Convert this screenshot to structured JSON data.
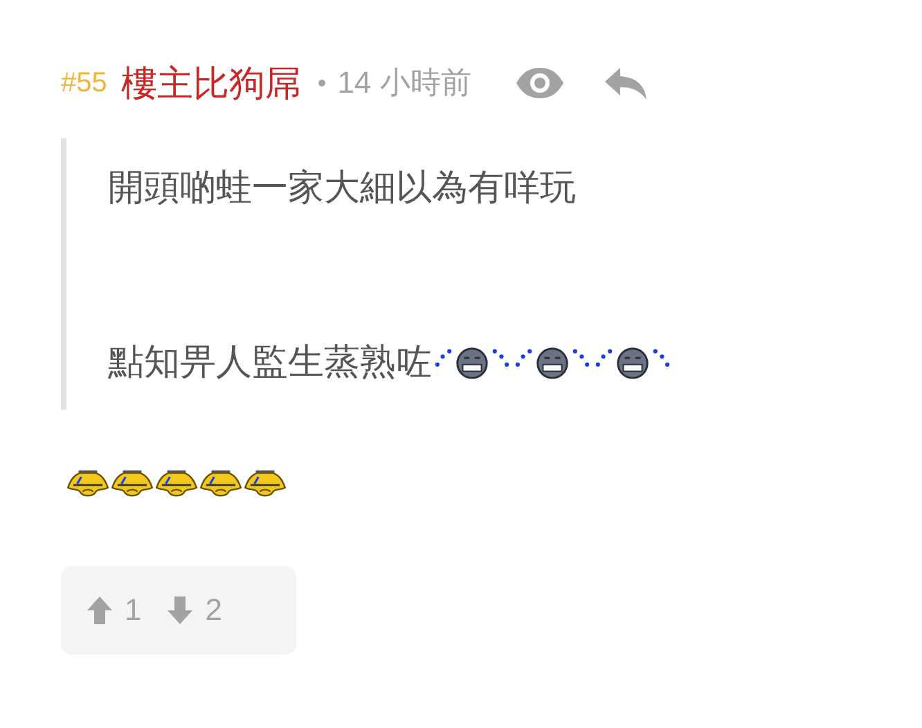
{
  "post": {
    "number": "#55",
    "author": "樓主比狗屌",
    "separator": "•",
    "time": "14 小時前",
    "quote": [
      {
        "text": "開頭啲蛙一家大細以為有咩玩"
      },
      {
        "text": "點知畀人監生蒸熟咗",
        "stickers": [
          {
            "kind": "sweat"
          },
          {
            "kind": "sweat"
          },
          {
            "kind": "sweat"
          }
        ]
      }
    ],
    "stickers": [
      {
        "kind": "crying"
      },
      {
        "kind": "crying"
      },
      {
        "kind": "crying"
      },
      {
        "kind": "crying"
      },
      {
        "kind": "crying"
      }
    ],
    "votes": {
      "up": "1",
      "down": "2"
    }
  }
}
